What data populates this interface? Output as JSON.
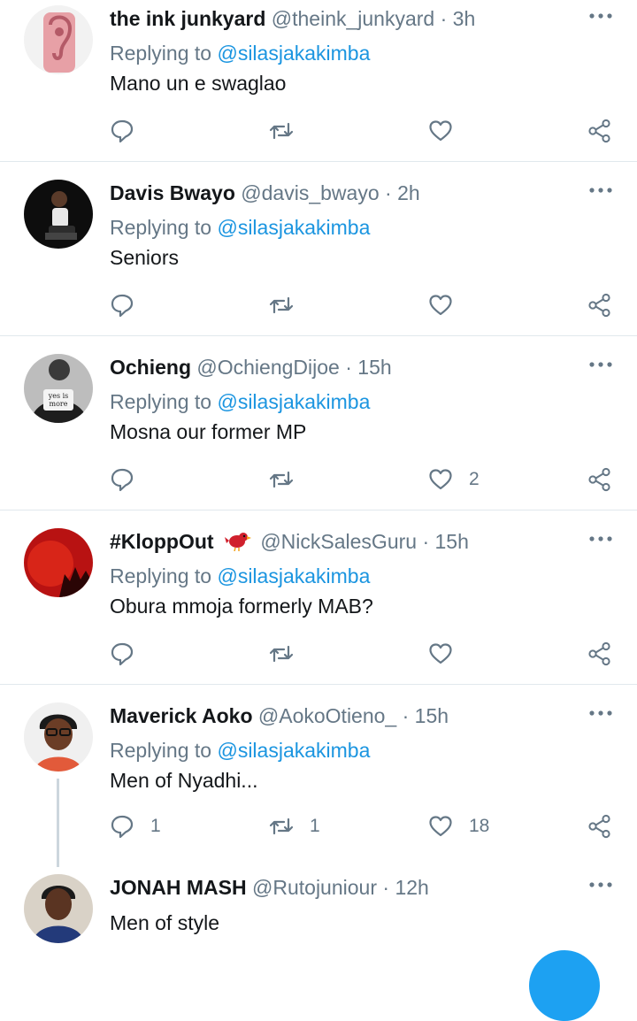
{
  "tweets": [
    {
      "name": "the ink junkyard",
      "handle": "@theink_junkyard",
      "time": "3h",
      "replying_prefix": "Replying to",
      "replying_to": "@silasjakakimba",
      "text": "Mano un e swaglao",
      "reply_count": "",
      "retweet_count": "",
      "like_count": ""
    },
    {
      "name": "Davis Bwayo",
      "handle": "@davis_bwayo",
      "time": "2h",
      "replying_prefix": "Replying to",
      "replying_to": "@silasjakakimba",
      "text": "Seniors",
      "reply_count": "",
      "retweet_count": "",
      "like_count": ""
    },
    {
      "name": "Ochieng",
      "handle": "@OchiengDijoe",
      "time": "15h",
      "replying_prefix": "Replying to",
      "replying_to": "@silasjakakimba",
      "text": "Mosna our former MP",
      "reply_count": "",
      "retweet_count": "",
      "like_count": "2",
      "avatar_text": "yes is more"
    },
    {
      "name": "#KloppOut",
      "handle": "@NickSalesGuru",
      "time": "15h",
      "replying_prefix": "Replying to",
      "replying_to": "@silasjakakimba",
      "text": "Obura mmoja formerly MAB?",
      "reply_count": "",
      "retweet_count": "",
      "like_count": ""
    },
    {
      "name": "Maverick Aoko",
      "handle": "@AokoOtieno_",
      "time": "15h",
      "replying_prefix": "Replying to",
      "replying_to": "@silasjakakimba",
      "text": "Men of Nyadhi...",
      "reply_count": "1",
      "retweet_count": "1",
      "like_count": "18"
    },
    {
      "name": "JONAH MASH",
      "handle": "@Rutojuniour",
      "time": "12h",
      "text": "Men of style"
    }
  ],
  "separator": "·",
  "colors": {
    "accent": "#1b95e0",
    "muted": "#657786",
    "text": "#14171a",
    "divider": "#e1e8ed"
  },
  "icons": {
    "reply": "reply-icon",
    "retweet": "retweet-icon",
    "like": "heart-icon",
    "share": "share-icon",
    "more": "more-icon",
    "name_emoji": "red-bird-emoji"
  }
}
